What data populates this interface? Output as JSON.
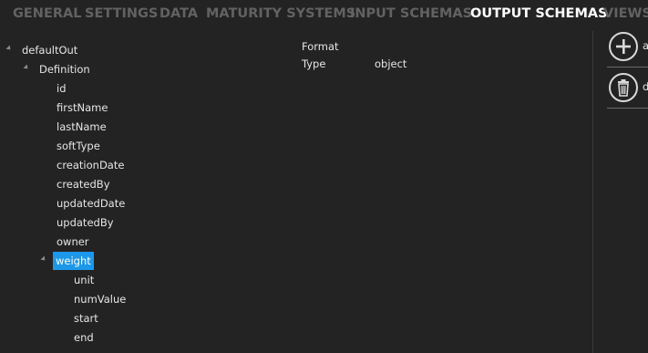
{
  "tabs": [
    "GENERAL",
    "SETTINGS",
    "DATA",
    "MATURITY SYSTEMS",
    "INPUT SCHEMAS",
    "OUTPUT SCHEMAS",
    "VIEWS"
  ],
  "active_tab": "OUTPUT SCHEMAS",
  "tree": {
    "root": "defaultOut",
    "definition": "Definition",
    "fields": [
      "id",
      "firstName",
      "lastName",
      "softType",
      "creationDate",
      "createdBy",
      "updatedDate",
      "updatedBy",
      "owner"
    ],
    "selected": "weight",
    "weight_children": [
      "unit",
      "numValue",
      "start",
      "end"
    ]
  },
  "properties": {
    "format_label": "Format",
    "format_value": "",
    "type_label": "Type",
    "type_value": "object"
  },
  "actions": {
    "add_label": "a",
    "delete_label": "d",
    "add_icon": "plus-circle-icon",
    "delete_icon": "trash-icon"
  },
  "colors": {
    "selection": "#1c97ea",
    "active_tab": "#ffffff",
    "inactive_tab": "#626262"
  }
}
